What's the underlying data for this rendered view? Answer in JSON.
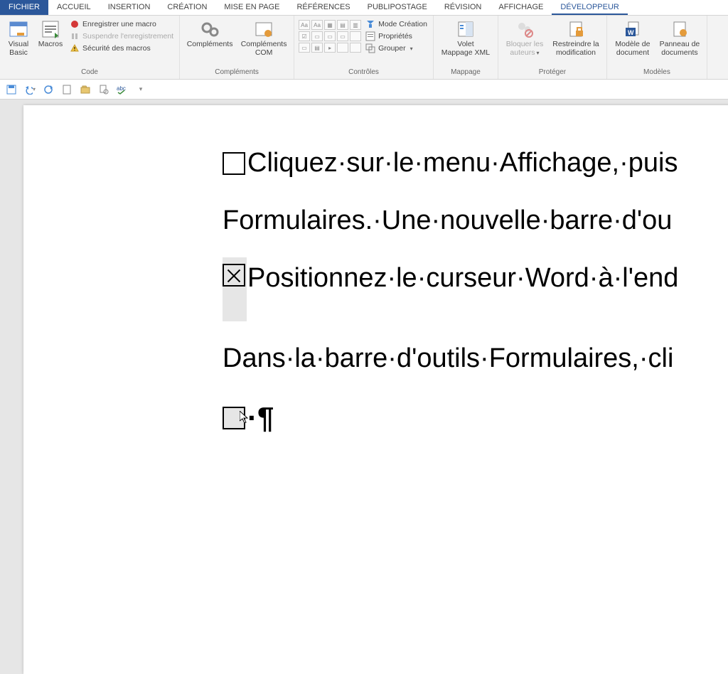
{
  "tabs": {
    "file": "FICHIER",
    "home": "ACCUEIL",
    "insert": "INSERTION",
    "design": "CRÉATION",
    "layout": "MISE EN PAGE",
    "references": "RÉFÉRENCES",
    "mailings": "PUBLIPOSTAGE",
    "review": "RÉVISION",
    "view": "AFFICHAGE",
    "developer": "DÉVELOPPEUR"
  },
  "ribbon": {
    "code": {
      "visual_basic": "Visual\nBasic",
      "macros": "Macros",
      "record": "Enregistrer une macro",
      "pause": "Suspendre l'enregistrement",
      "security": "Sécurité des macros",
      "label": "Code"
    },
    "addins": {
      "addins": "Compléments",
      "com_addins": "Compléments\nCOM",
      "label": "Compléments"
    },
    "controls": {
      "design_mode": "Mode Création",
      "properties": "Propriétés",
      "group": "Grouper",
      "label": "Contrôles"
    },
    "mapping": {
      "xml_pane": "Volet\nMappage XML",
      "label": "Mappage"
    },
    "protect": {
      "block_authors": "Bloquer les\nauteurs",
      "restrict_edit": "Restreindre la\nmodification",
      "label": "Protéger"
    },
    "templates": {
      "doc_template": "Modèle de\ndocument",
      "doc_panel": "Panneau de\ndocuments",
      "label": "Modèles"
    }
  },
  "document": {
    "line1": "Cliquez·sur·le·menu·Affichage,·puis",
    "line2": "Formulaires.·Une·nouvelle·barre·d'ou",
    "line3": "Positionnez·le·curseur·Word·à·l'end",
    "line4": "Dans·la·barre·d'outils·Formulaires,·cli",
    "pilcrow": "·¶"
  }
}
